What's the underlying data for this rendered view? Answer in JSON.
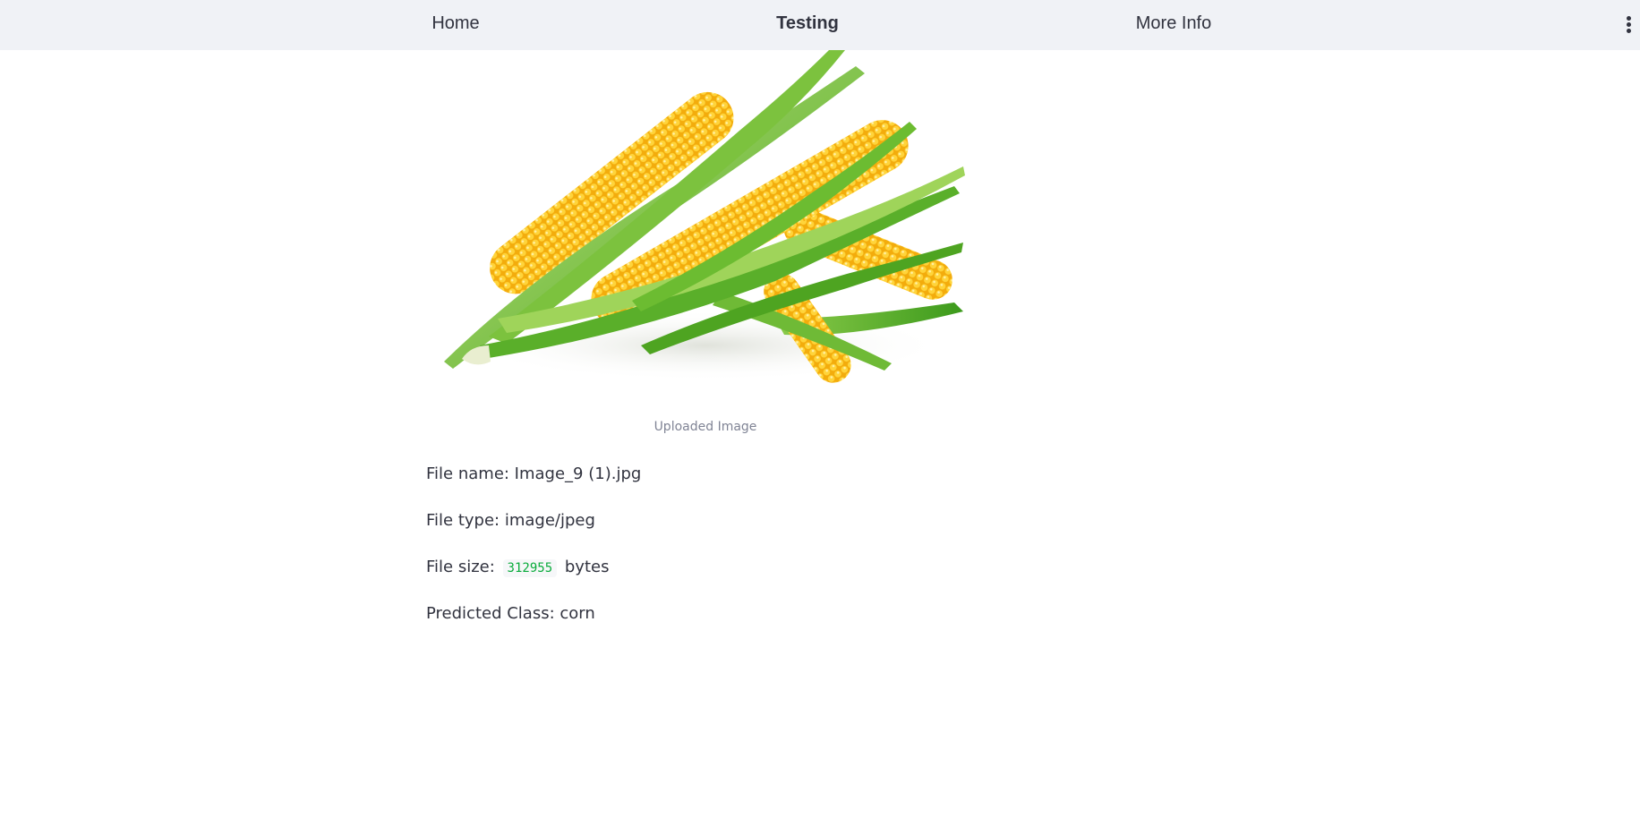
{
  "nav": {
    "items": [
      {
        "label": "Home"
      },
      {
        "label": "Testing"
      },
      {
        "label": "More Info"
      }
    ],
    "menu_icon": "vertical-ellipsis-icon"
  },
  "image": {
    "caption": "Uploaded Image",
    "subject": "ears of corn"
  },
  "file_info": {
    "name_label": "File name: Image_9 (1).jpg",
    "type_label": "File type: image/jpeg",
    "size_prefix": "File size:",
    "size_value": "312955",
    "size_suffix": "bytes",
    "prediction": "Predicted Class: corn"
  },
  "colors": {
    "navbar_bg": "#f0f2f6",
    "text": "#31333f",
    "caption": "#808495",
    "code_green": "#09ab3b"
  }
}
